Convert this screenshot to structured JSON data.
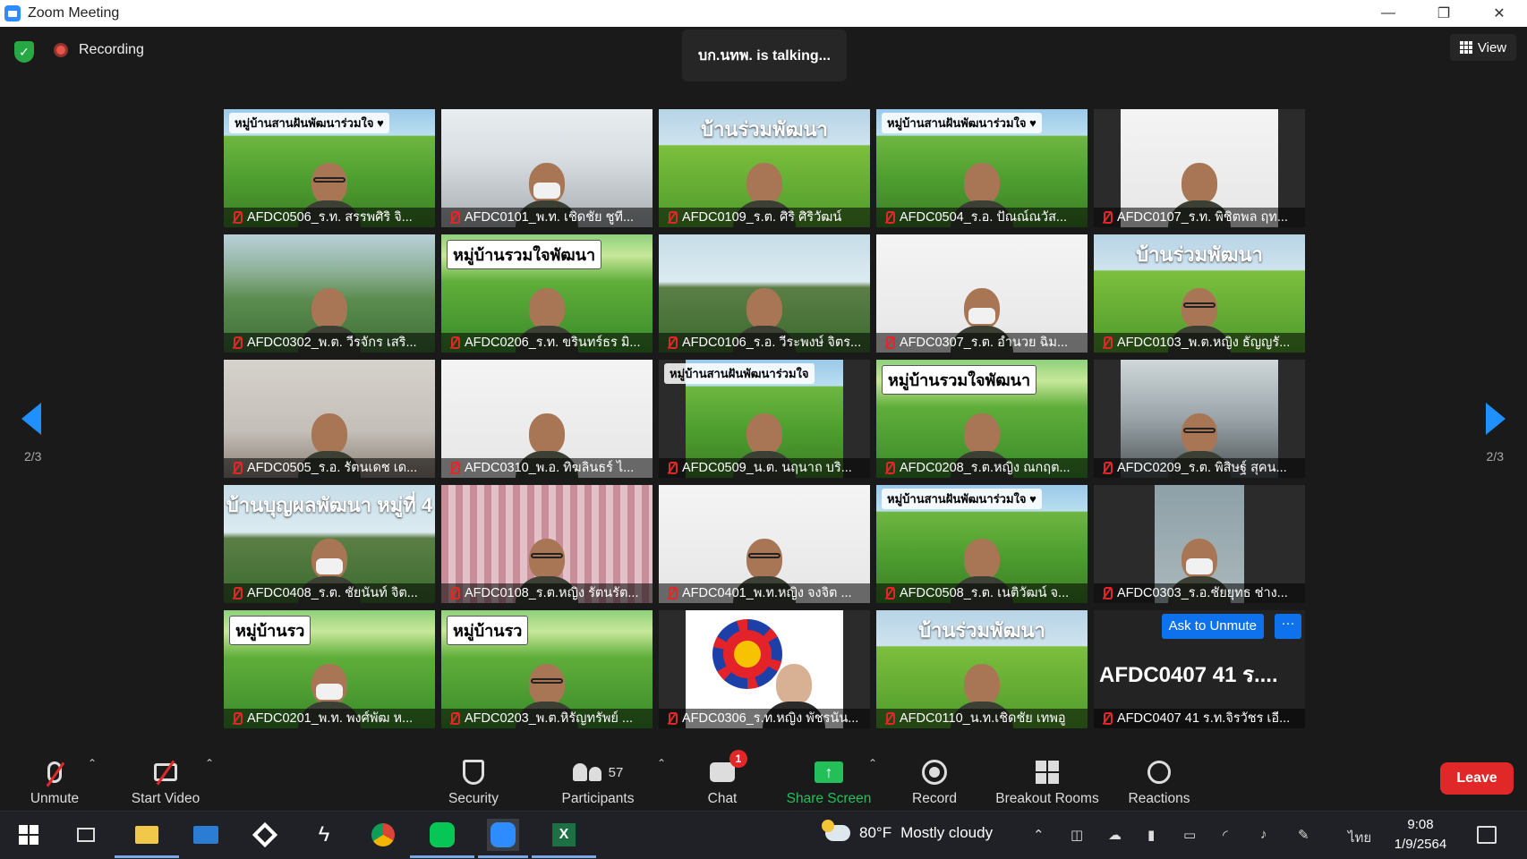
{
  "window": {
    "title": "Zoom Meeting",
    "minimize": "—",
    "restore": "❐",
    "close": "✕"
  },
  "topbar": {
    "recording": "Recording",
    "talking": "บก.นทพ. is talking...",
    "view": "View"
  },
  "paging": {
    "left": "2/3",
    "right": "2/3"
  },
  "tiles": [
    {
      "name": "AFDC0506_ร.ท. สรรพศิริ  จิ...",
      "scene": "green",
      "banner": "หมู่บ้านสานฝันพัฒนาร่วมใจ ♥",
      "btype": "",
      "glasses": true
    },
    {
      "name": "AFDC0101_พ.ท. เชิดชัย  ชูที...",
      "scene": "office",
      "banner": "",
      "btype": "",
      "mask": true
    },
    {
      "name": "AFDC0109_ร.ต. ศิริ  ศิริวัฒน์",
      "scene": "rice",
      "banner": "บ้านร่วมพัฒนา",
      "btype": "title"
    },
    {
      "name": "AFDC0504_ร.อ. ปัณณ์ณวัส...",
      "scene": "green",
      "banner": "หมู่บ้านสานฝันพัฒนาร่วมใจ ♥",
      "btype": ""
    },
    {
      "name": "AFDC0107_ร.ท. พิชิตพล  ฤท...",
      "scene": "white",
      "banner": "",
      "btype": "",
      "inset": true
    },
    {
      "name": "AFDC0302_พ.ต. วีรจักร  เสริ...",
      "scene": "mtn",
      "banner": "",
      "btype": ""
    },
    {
      "name": "AFDC0206_ร.ท. ขรินทร์ธร  มิ...",
      "scene": "village",
      "banner": "หมู่บ้านรวมใจพัฒนา",
      "btype": "big"
    },
    {
      "name": "AFDC0106_ร.อ. วีระพงษ์  จิตร...",
      "scene": "farm",
      "banner": "",
      "btype": ""
    },
    {
      "name": "AFDC0307_ร.ต. อำนวย  ฉิม...",
      "scene": "white",
      "banner": "",
      "btype": "",
      "mask": true
    },
    {
      "name": "AFDC0103_พ.ต.หญิง ธัญญรั...",
      "scene": "rice",
      "banner": "บ้านร่วมพัฒนา",
      "btype": "title",
      "glasses": true
    },
    {
      "name": "AFDC0505_ร.อ. รัตนเดช  เด...",
      "scene": "wall",
      "banner": "",
      "btype": ""
    },
    {
      "name": "AFDC0310_พ.อ. ทิฆลินธร์  ไ...",
      "scene": "white",
      "banner": "",
      "btype": ""
    },
    {
      "name": "AFDC0509_น.ต. นฤนาถ  บริ...",
      "scene": "green",
      "banner": "หมู่บ้านสานฝันพัฒนาร่วมใจ",
      "btype": "",
      "inset": true
    },
    {
      "name": "AFDC0208_ร.ต.หญิง ณกฤต...",
      "scene": "village",
      "banner": "หมู่บ้านรวมใจพัฒนา",
      "btype": "big"
    },
    {
      "name": "AFDC0209_ร.ต. พิสิษฐ์  สุคน...",
      "scene": "car",
      "banner": "",
      "btype": "",
      "inset": true,
      "glasses": true
    },
    {
      "name": "AFDC0408_ร.ต. ชัยนันท์  จิต...",
      "scene": "farm",
      "banner": "บ้านบุญผลพัฒนา หมู่ที่ 4",
      "btype": "title",
      "mask": true
    },
    {
      "name": "AFDC0108_ร.ต.หญิง รัตนรัต...",
      "scene": "curtain",
      "banner": "",
      "btype": "",
      "glasses": true
    },
    {
      "name": "AFDC0401_พ.ท.หญิง จงจิต ...",
      "scene": "white",
      "banner": "",
      "btype": "",
      "glasses": true
    },
    {
      "name": "AFDC0508_ร.ต. เนติวัฒน์  จ...",
      "scene": "green",
      "banner": "หมู่บ้านสานฝันพัฒนาร่วมใจ ♥",
      "btype": ""
    },
    {
      "name": "AFDC0303_ร.อ.ชัยยุทธ  ช่าง...",
      "scene": "gray",
      "banner": "",
      "btype": "",
      "inset": true,
      "mask": true
    },
    {
      "name": "AFDC0201_พ.ท. พงศ์พัฒ  ห...",
      "scene": "village",
      "banner": "หมู่บ้านรว",
      "btype": "big",
      "mask": true
    },
    {
      "name": "AFDC0203_พ.ต.หิรัญทรัพย์ ...",
      "scene": "village",
      "banner": "หมู่บ้านรว",
      "btype": "big",
      "glasses": true
    },
    {
      "name": "AFDC0306_ร.ท.หญิง พัชรนัน...",
      "scene": "logo",
      "banner": "",
      "btype": ""
    },
    {
      "name": "AFDC0110_น.ท.เชิดชัย  เทพอู",
      "scene": "rice",
      "banner": "บ้านร่วมพัฒนา",
      "btype": "title"
    },
    {
      "name": "AFDC0407 41 ร.ท.จิรวัชร เอี...",
      "scene": "none",
      "banner": "",
      "btype": "",
      "bigname": "AFDC0407  41 ร....",
      "ask": "Ask to Unmute",
      "more": "···"
    }
  ],
  "toolbar": {
    "unmute": "Unmute",
    "start_video": "Start Video",
    "security": "Security",
    "participants": "Participants",
    "participants_count": "57",
    "chat": "Chat",
    "chat_badge": "1",
    "share": "Share Screen",
    "record": "Record",
    "breakout": "Breakout Rooms",
    "reactions": "Reactions",
    "leave": "Leave",
    "caret": "⌃",
    "share_arrow": "↑"
  },
  "taskbar": {
    "weather_temp": "80°F",
    "weather_text": "Mostly cloudy",
    "lang": "ไทย",
    "time": "9:08",
    "date": "1/9/2564"
  }
}
